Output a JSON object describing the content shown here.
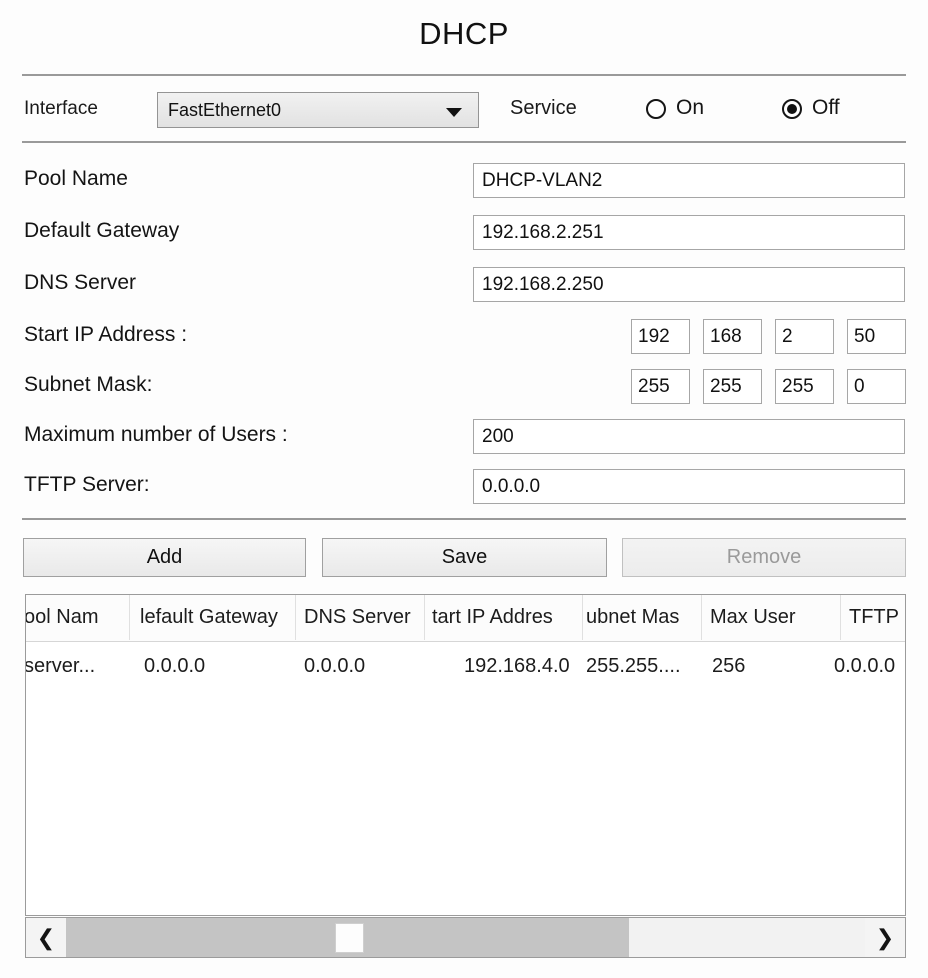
{
  "window": {
    "title": "DHCP"
  },
  "interface_row": {
    "label": "Interface",
    "selected_interface": "FastEthernet0",
    "caret_icon": "chevron-down-icon",
    "service_label": "Service",
    "radios": [
      {
        "label": "On",
        "checked": false
      },
      {
        "label": "Off",
        "checked": true
      }
    ]
  },
  "form": {
    "fields": [
      {
        "label": "Pool Name",
        "type": "text",
        "value": "DHCP-VLAN2"
      },
      {
        "label": "Default Gateway",
        "type": "text",
        "value": "192.168.2.251"
      },
      {
        "label": "DNS Server",
        "type": "text",
        "value": "192.168.2.250"
      },
      {
        "label": "Start IP Address :",
        "type": "octet",
        "octets": [
          "192",
          "168",
          "2",
          "50"
        ]
      },
      {
        "label": "Subnet Mask:",
        "type": "octet",
        "octets": [
          "255",
          "255",
          "255",
          "0"
        ]
      },
      {
        "label": "Maximum number of Users :",
        "type": "text",
        "value": "200"
      },
      {
        "label": "TFTP Server:",
        "type": "text",
        "value": "0.0.0.0"
      }
    ]
  },
  "buttons": {
    "add": "Add",
    "save": "Save",
    "remove": "Remove"
  },
  "table": {
    "headers": [
      "ool Nam",
      "lefault Gateway",
      "DNS Server",
      "tart IP Addres",
      "ubnet Mas",
      "Max User",
      "TFTP"
    ],
    "rows": [
      [
        "server...",
        "0.0.0.0",
        "0.0.0.0",
        "192.168.4.0",
        "255.255....",
        "256",
        "0.0.0.0"
      ]
    ]
  },
  "scrollbar": {
    "left_arrow_icon": "chevron-left-icon",
    "right_arrow_icon": "chevron-right-icon"
  },
  "colors": {
    "rule": "#9a9a9a",
    "border": "#a6a6a6",
    "disabled_text": "#9a9a9a",
    "scroll_fill": "#c4c4c4"
  }
}
